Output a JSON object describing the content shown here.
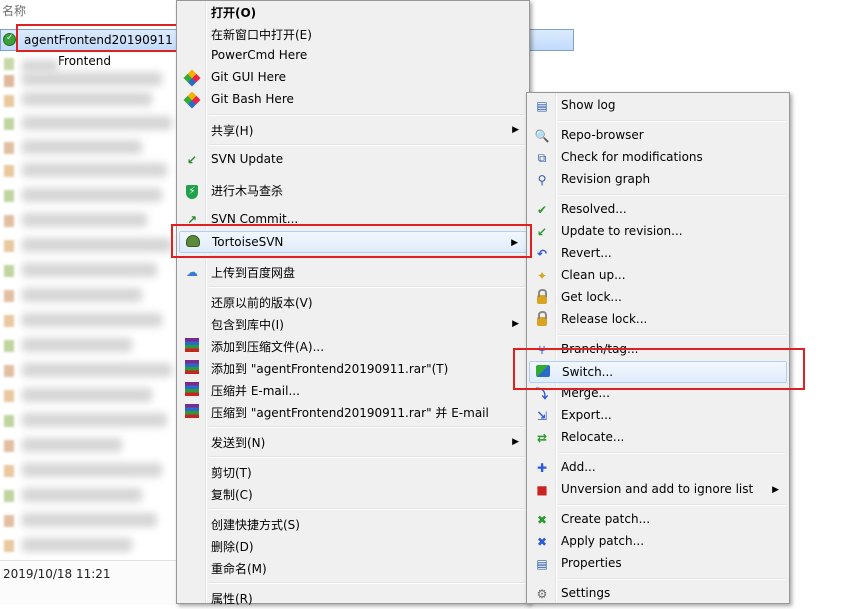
{
  "explorer": {
    "column_header": "名称",
    "selected_item": "agentFrontend20190911",
    "sibling_fragment": "Frontend",
    "date_text": "2019/10/18 11:21"
  },
  "main_menu": {
    "items": [
      {
        "label": "打开(O)",
        "icon": "none",
        "bold": true
      },
      {
        "label": "在新窗口中打开(E)",
        "icon": "none"
      },
      {
        "label": "PowerCmd Here",
        "icon": "none"
      },
      {
        "label": "Git GUI Here",
        "icon": "git-icon"
      },
      {
        "label": "Git Bash Here",
        "icon": "git-icon"
      },
      {
        "label": "共享(H)",
        "icon": "none",
        "submenu": true
      },
      {
        "label": "SVN Update",
        "icon": "svn-update-icon"
      },
      {
        "label": "进行木马查杀",
        "icon": "shield-icon"
      },
      {
        "label": "SVN Commit...",
        "icon": "svn-commit-icon"
      },
      {
        "label": "TortoiseSVN",
        "icon": "tortoise-icon",
        "submenu": true
      },
      {
        "label": "上传到百度网盘",
        "icon": "cloud-icon"
      },
      {
        "label": "还原以前的版本(V)",
        "icon": "none"
      },
      {
        "label": "包含到库中(I)",
        "icon": "none",
        "submenu": true
      },
      {
        "label": "添加到压缩文件(A)...",
        "icon": "winrar-icon"
      },
      {
        "label": "添加到 \"agentFrontend20190911.rar\"(T)",
        "icon": "winrar-icon"
      },
      {
        "label": "压缩并 E-mail...",
        "icon": "winrar-icon"
      },
      {
        "label": "压缩到 \"agentFrontend20190911.rar\" 并 E-mail",
        "icon": "winrar-icon"
      },
      {
        "label": "发送到(N)",
        "icon": "none",
        "submenu": true
      },
      {
        "label": "剪切(T)",
        "icon": "none"
      },
      {
        "label": "复制(C)",
        "icon": "none"
      },
      {
        "label": "创建快捷方式(S)",
        "icon": "none"
      },
      {
        "label": "删除(D)",
        "icon": "none"
      },
      {
        "label": "重命名(M)",
        "icon": "none"
      },
      {
        "label": "属性(R)",
        "icon": "none"
      }
    ]
  },
  "svn_menu": {
    "items": [
      {
        "label": "Show log",
        "icon": "log-icon"
      },
      {
        "label": "Repo-browser",
        "icon": "repo-browser-icon"
      },
      {
        "label": "Check for modifications",
        "icon": "check-modifications-icon"
      },
      {
        "label": "Revision graph",
        "icon": "revision-graph-icon"
      },
      {
        "label": "Resolved...",
        "icon": "resolved-icon"
      },
      {
        "label": "Update to revision...",
        "icon": "update-revision-icon"
      },
      {
        "label": "Revert...",
        "icon": "revert-icon"
      },
      {
        "label": "Clean up...",
        "icon": "cleanup-icon"
      },
      {
        "label": "Get lock...",
        "icon": "lock-icon"
      },
      {
        "label": "Release lock...",
        "icon": "unlock-icon"
      },
      {
        "label": "Branch/tag...",
        "icon": "branch-icon"
      },
      {
        "label": "Switch...",
        "icon": "switch-icon"
      },
      {
        "label": "Merge...",
        "icon": "merge-icon"
      },
      {
        "label": "Export...",
        "icon": "export-icon"
      },
      {
        "label": "Relocate...",
        "icon": "relocate-icon"
      },
      {
        "label": "Add...",
        "icon": "add-icon"
      },
      {
        "label": "Unversion and add to ignore list",
        "icon": "ignore-icon",
        "submenu": true
      },
      {
        "label": "Create patch...",
        "icon": "create-patch-icon"
      },
      {
        "label": "Apply patch...",
        "icon": "apply-patch-icon"
      },
      {
        "label": "Properties",
        "icon": "properties-icon"
      },
      {
        "label": "Settings",
        "icon": "settings-icon"
      }
    ]
  },
  "colors": {
    "highlight_box": "#e02020",
    "menu_bg": "#f0f0f0",
    "hover_bg": "#e0ecfb"
  }
}
